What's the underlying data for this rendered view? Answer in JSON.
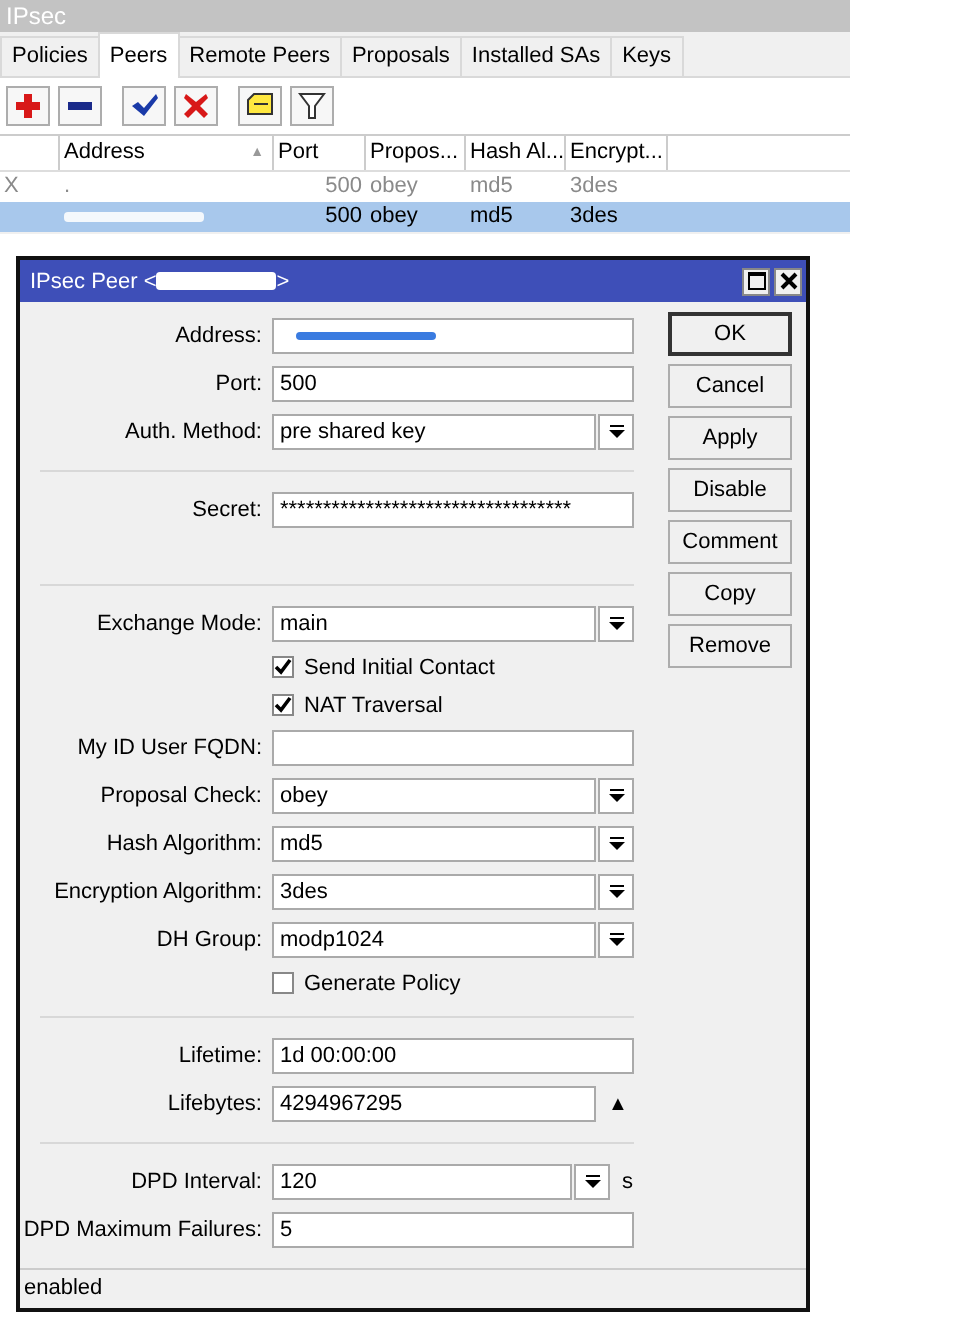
{
  "window": {
    "title": "IPsec"
  },
  "tabs": [
    {
      "label": "Policies",
      "selected": false
    },
    {
      "label": "Peers",
      "selected": true
    },
    {
      "label": "Remote Peers",
      "selected": false
    },
    {
      "label": "Proposals",
      "selected": false
    },
    {
      "label": "Installed SAs",
      "selected": false
    },
    {
      "label": "Keys",
      "selected": false
    }
  ],
  "toolbar": [
    {
      "kind": "add"
    },
    {
      "kind": "remove"
    },
    {
      "kind": "enable"
    },
    {
      "kind": "disable"
    },
    {
      "kind": "comment"
    },
    {
      "kind": "filter"
    }
  ],
  "table": {
    "columns": [
      {},
      {
        "label": "Address",
        "sort": "▲"
      },
      {
        "label": "Port"
      },
      {
        "label": "Propos..."
      },
      {
        "label": "Hash Al..."
      },
      {
        "label": "Encrypt..."
      }
    ],
    "rows": [
      {
        "disabled": true,
        "selected": false,
        "redacted": false,
        "cells": [
          "X",
          ".",
          "500",
          "obey",
          "md5",
          "3des"
        ]
      },
      {
        "disabled": false,
        "selected": true,
        "redacted": true,
        "cells": [
          null,
          null,
          "500",
          "obey",
          "md5",
          "3des"
        ]
      }
    ]
  },
  "dialog": {
    "title_prefix": "IPsec Peer <",
    "title_suffix": ">",
    "title_redacted": true,
    "fields": [
      {
        "kind": "text",
        "label": "Address:",
        "redacted": true
      },
      {
        "kind": "text",
        "label": "Port:",
        "value": "500"
      },
      {
        "kind": "select",
        "label": "Auth. Method:",
        "value": "pre shared key"
      },
      {
        "kind": "separator"
      },
      {
        "kind": "text",
        "label": "Secret:",
        "value": "**********************************"
      },
      {
        "kind": "spacer"
      },
      {
        "kind": "separator"
      },
      {
        "kind": "select",
        "label": "Exchange Mode:",
        "value": "main"
      },
      {
        "kind": "checkbox",
        "label": "Send Initial Contact",
        "checked": true
      },
      {
        "kind": "checkbox",
        "label": "NAT Traversal",
        "checked": true
      },
      {
        "kind": "text",
        "label": "My ID User FQDN:"
      },
      {
        "kind": "select",
        "label": "Proposal Check:",
        "value": "obey"
      },
      {
        "kind": "select",
        "label": "Hash Algorithm:",
        "value": "md5"
      },
      {
        "kind": "select",
        "label": "Encryption Algorithm:",
        "value": "3des"
      },
      {
        "kind": "select",
        "label": "DH Group:",
        "value": "modp1024"
      },
      {
        "kind": "checkbox",
        "label": "Generate Policy",
        "checked": false
      },
      {
        "kind": "separator"
      },
      {
        "kind": "text",
        "label": "Lifetime:",
        "value": "1d 00:00:00"
      },
      {
        "kind": "collapse",
        "label": "Lifebytes:",
        "value": "4294967295",
        "toggle": "▲"
      },
      {
        "kind": "separator"
      },
      {
        "kind": "unitselect",
        "label": "DPD Interval:",
        "value": "120",
        "unit": "s"
      },
      {
        "kind": "text",
        "label": "DPD Maximum Failures:",
        "value": "5"
      }
    ],
    "buttons": [
      {
        "label": "OK",
        "default": true
      },
      {
        "label": "Cancel",
        "default": false
      },
      {
        "label": "Apply",
        "default": false
      },
      {
        "label": "Disable",
        "default": false
      },
      {
        "label": "Comment",
        "default": false
      },
      {
        "label": "Copy",
        "default": false
      },
      {
        "label": "Remove",
        "default": false
      }
    ],
    "status_bar": "enabled"
  }
}
